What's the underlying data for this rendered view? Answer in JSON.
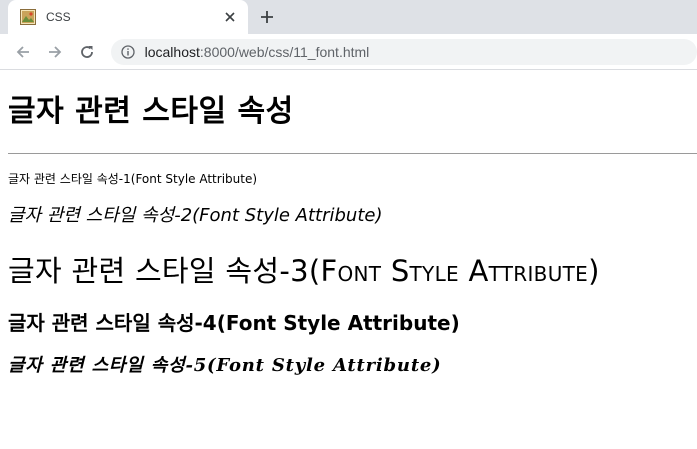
{
  "browser": {
    "tab_title": "CSS",
    "url_host": "localhost",
    "url_path": ":8000/web/css/11_font.html"
  },
  "page": {
    "heading": "글자 관련 스타일 속성",
    "lines": [
      "글자 관련 스타일 속성-1(Font Style Attribute)",
      "글자 관련 스타일 속성-2(Font Style Attribute)",
      "글자 관련 스타일 속성-3(Font Style Attribute)",
      "글자 관련 스타일 속성-4(Font Style Attribute)",
      "글자 관련 스타일 속성-5(Font Style Attribute)"
    ]
  },
  "colors": {
    "chrome_background": "#dee1e6",
    "omnibox_background": "#f1f3f4",
    "rule": "#9a9a9a"
  },
  "icons": {
    "favicon": "image-favicon-icon",
    "close": "close-icon",
    "new_tab": "plus-icon",
    "back": "arrow-left-icon",
    "forward": "arrow-right-icon",
    "reload": "reload-icon",
    "site_info": "info-icon"
  }
}
